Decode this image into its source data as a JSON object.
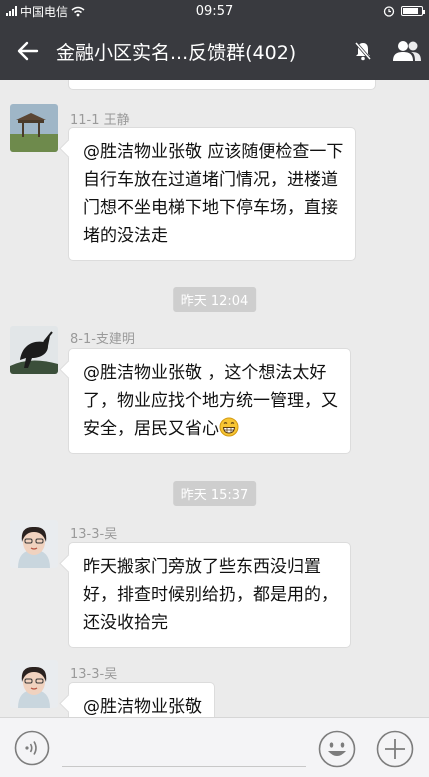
{
  "status_bar": {
    "carrier": "中国电信",
    "time": "09:57",
    "battery_level": 0.85
  },
  "header": {
    "title": "金融小区实名...反馈群(402)",
    "icons": [
      "back-arrow-icon",
      "mute-icon",
      "group-members-icon"
    ]
  },
  "messages": [
    {
      "sender": "11-1 王静",
      "lines": [
        "@胜洁物业张敬 应该随便检查一下",
        "自行车放在过道堵门情况，进楼道",
        "门想不坐电梯下地下停车场，直接",
        "堵的没法走"
      ]
    },
    {
      "timestamp": "昨天 12:04"
    },
    {
      "sender": "8-1-支建明",
      "lines": [
        "@胜洁物业张敬 ，这个想法太好",
        "了，物业应找个地方统一管理，又",
        "安全，居民又省心"
      ],
      "trailing_emoji": "grin-emoji"
    },
    {
      "timestamp": "昨天 15:37"
    },
    {
      "sender": "13-3-吴",
      "lines": [
        "昨天搬家门旁放了些东西没归置",
        "好，排查时候别给扔，都是用的，",
        "还没收拾完"
      ]
    },
    {
      "sender": "13-3-吴",
      "lines": [
        "@胜洁物业张敬"
      ]
    }
  ],
  "input_bar": {
    "icons": [
      "voice-icon",
      "emoji-icon",
      "plus-icon"
    ]
  }
}
